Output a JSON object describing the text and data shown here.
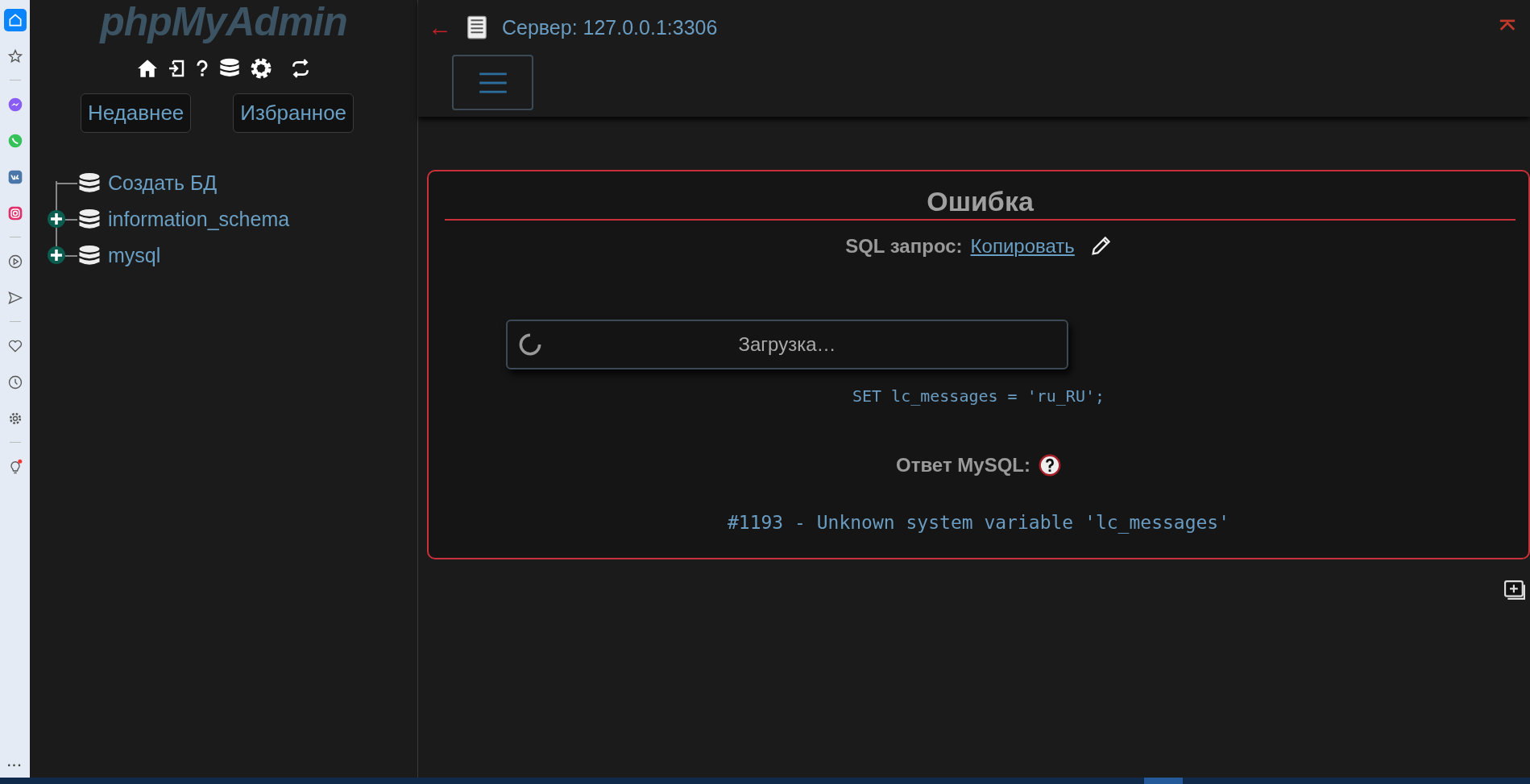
{
  "browser_sidebar": {
    "items": [
      {
        "kind": "home",
        "selected": true
      },
      {
        "kind": "star",
        "selected": false
      },
      {
        "kind": "divider"
      },
      {
        "kind": "messenger",
        "selected": false
      },
      {
        "kind": "whatsapp",
        "selected": false
      },
      {
        "kind": "vk",
        "selected": false
      },
      {
        "kind": "instagram",
        "selected": false
      },
      {
        "kind": "divider"
      },
      {
        "kind": "play",
        "selected": false
      },
      {
        "kind": "send",
        "selected": false
      },
      {
        "kind": "divider"
      },
      {
        "kind": "heart",
        "selected": false
      },
      {
        "kind": "clock",
        "selected": false
      },
      {
        "kind": "gear",
        "selected": false
      },
      {
        "kind": "divider"
      },
      {
        "kind": "bulb",
        "selected": false
      }
    ],
    "more": "···"
  },
  "navigation": {
    "logo": "phpMyAdmin",
    "buttons": [
      "Недавнее",
      "Избранное"
    ],
    "tree": [
      {
        "label": "Создать БД",
        "expandable": false
      },
      {
        "label": "information_schema",
        "expandable": true
      },
      {
        "label": "mysql",
        "expandable": true
      }
    ]
  },
  "header": {
    "back": "←",
    "server": "Сервер: 127.0.0.1:3306"
  },
  "error": {
    "title": "Ошибка",
    "sql_label": "SQL запрос:",
    "copy_link": "Копировать",
    "loading": "Загрузка…",
    "query": "SET lc_messages = 'ru_RU';",
    "answer_label": "Ответ MySQL:",
    "message": "#1193 - Unknown system variable 'lc_messages'"
  }
}
